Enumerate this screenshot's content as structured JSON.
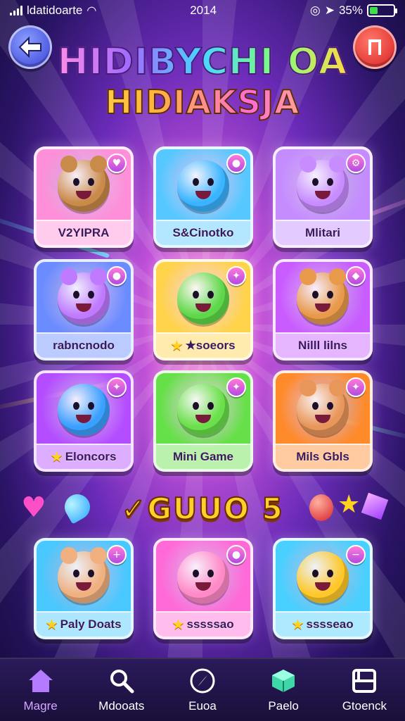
{
  "status_bar": {
    "carrier": "ldatidoarte",
    "time": "2014",
    "battery": "35%",
    "battery_fraction": 0.35
  },
  "header": {
    "back_icon": "arrow-left-icon",
    "music_icon": "music-note-icon",
    "title_line1": "HIDIBYCHI OA",
    "title_line2": "HIDIAKSJA"
  },
  "games": [
    {
      "label": "V2YIPRA",
      "badge_icon": "heart-icon",
      "has_star": false,
      "color": "#ff8fd8"
    },
    {
      "label": "S&Cinotko",
      "badge_icon": "coin-icon",
      "has_star": false,
      "color": "#57c8ff"
    },
    {
      "label": "Mlitari",
      "badge_icon": "gear-icon",
      "has_star": false,
      "color": "#c48cff"
    },
    {
      "label": "rabncnodo",
      "badge_icon": "coin-icon",
      "has_star": false,
      "color": "#6a8cff"
    },
    {
      "label": "★soeors",
      "badge_icon": "sparkle-icon",
      "has_star": true,
      "color": "#ffd34a"
    },
    {
      "label": "Nilll lilns",
      "badge_icon": "gem-icon",
      "has_star": false,
      "color": "#c85cff"
    },
    {
      "label": "Eloncors",
      "badge_icon": "sparkle-icon",
      "has_star": true,
      "color": "#b44dff"
    },
    {
      "label": "Mini Game",
      "badge_icon": "sparkle-icon",
      "has_star": false,
      "color": "#66e048"
    },
    {
      "label": "Mils Gbls",
      "badge_icon": "sparkle-icon",
      "has_star": false,
      "color": "#ff8a2a"
    },
    {
      "label": "Paly Doats",
      "badge_icon": "plus-icon",
      "has_star": true,
      "color": "#49c8ff"
    },
    {
      "label": "sssssao",
      "badge_icon": "coin-icon",
      "has_star": true,
      "color": "#ff6ad8"
    },
    {
      "label": "sssseao",
      "badge_icon": "minus-icon",
      "has_star": true,
      "color": "#49d0ff"
    }
  ],
  "level_banner": "✓GUUO 5",
  "nav": [
    {
      "label": "Magre",
      "icon": "home-icon",
      "active": true
    },
    {
      "label": "Mdooats",
      "icon": "search-icon",
      "active": false
    },
    {
      "label": "Euoa",
      "icon": "compass-icon",
      "active": false
    },
    {
      "label": "Paelo",
      "icon": "cube-icon",
      "active": false
    },
    {
      "label": "Gtoenck",
      "icon": "box-icon",
      "active": false
    }
  ]
}
